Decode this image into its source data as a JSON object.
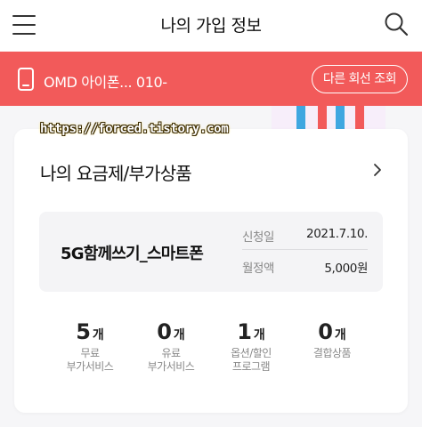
{
  "header": {
    "title": "나의 가입 정보",
    "menu_icon": "hamburger-menu-icon",
    "search_icon": "search-icon"
  },
  "line": {
    "label": "OMD 아이폰...  010-",
    "switch_label": "다른 회선 조회",
    "phone_icon": "phone-icon"
  },
  "watermark": "https://forced.tistory.com",
  "card": {
    "title": "나의 요금제/부가상품",
    "plan": {
      "name": "5G함께쓰기_스마트폰",
      "rows": [
        {
          "label": "신청일",
          "value": "2021.7.10."
        },
        {
          "label": "월정액",
          "value": "5,000원"
        }
      ]
    },
    "stats": [
      {
        "count": "5",
        "unit": "개",
        "label_line1": "무료",
        "label_line2": "부가서비스"
      },
      {
        "count": "0",
        "unit": "개",
        "label_line1": "유료",
        "label_line2": "부가서비스"
      },
      {
        "count": "1",
        "unit": "개",
        "label_line1": "옵션/할인",
        "label_line2": "프로그램"
      },
      {
        "count": "0",
        "unit": "개",
        "label_line1": "결합상품",
        "label_line2": ""
      }
    ]
  },
  "colors": {
    "accent": "#f25a5a",
    "background": "#f6f6f8"
  }
}
